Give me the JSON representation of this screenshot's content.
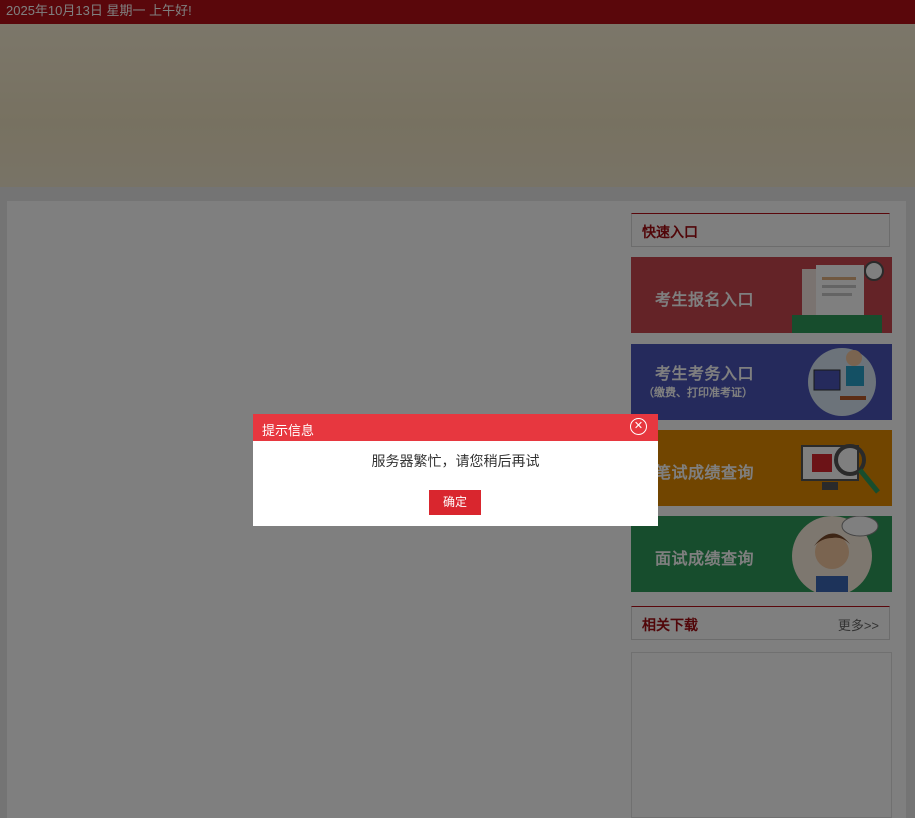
{
  "topbar": {
    "date_text": "2025年10月13日  星期一  上午好!"
  },
  "sidebar": {
    "quick_entry_title": "快速入口",
    "tiles": [
      {
        "label": "考生报名入口",
        "color": "#c9464f"
      },
      {
        "label": "考生考务入口",
        "sub": "（缴费、打印准考证）",
        "color": "#4a55b8"
      },
      {
        "label": "笔试成绩查询",
        "color": "#e28b00"
      },
      {
        "label": "面试成绩查询",
        "color": "#2f9a5a"
      }
    ],
    "downloads_title": "相关下载",
    "downloads_more": "更多>>"
  },
  "dialog": {
    "title": "提示信息",
    "message": "服务器繁忙，请您稍后再试",
    "confirm_label": "确定"
  },
  "colors": {
    "brand_red": "#b40f16",
    "dialog_header": "#e7373f",
    "button_red": "#d9262e"
  }
}
